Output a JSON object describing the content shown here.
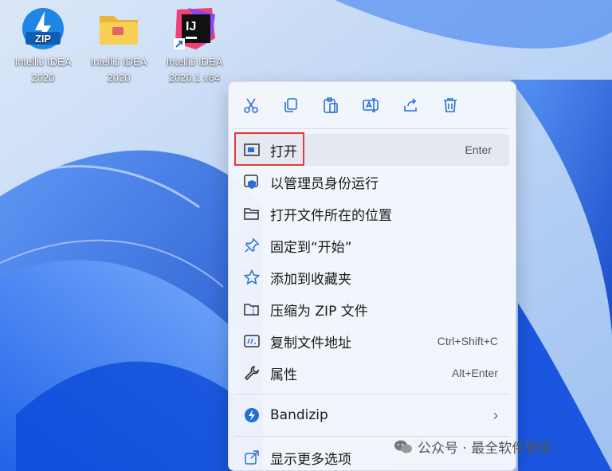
{
  "desktop": {
    "icons": [
      {
        "line1": "IntelliJ IDEA",
        "line2": "2020",
        "icon": "bandizip-zip-icon",
        "badge": "ZIP"
      },
      {
        "line1": "IntelliJ IDEA",
        "line2": "2020",
        "icon": "folder-icon"
      },
      {
        "line1": "IntelliJ IDEA",
        "line2": "2020.1 x64",
        "icon": "intellij-idea-icon",
        "badge": "IJ"
      }
    ]
  },
  "menu": {
    "toolbar": [
      "cut-icon",
      "copy-icon",
      "paste-icon",
      "rename-icon",
      "share-icon",
      "delete-icon"
    ],
    "items": [
      {
        "label": "打开",
        "shortcut": "Enter"
      },
      {
        "label": "以管理员身份运行",
        "shortcut": ""
      },
      {
        "label": "打开文件所在的位置",
        "shortcut": ""
      },
      {
        "label": "固定到“开始”",
        "shortcut": ""
      },
      {
        "label": "添加到收藏夹",
        "shortcut": ""
      },
      {
        "label": "压缩为 ZIP 文件",
        "shortcut": ""
      },
      {
        "label": "复制文件地址",
        "shortcut": "Ctrl+Shift+C"
      },
      {
        "label": "属性",
        "shortcut": "Alt+Enter"
      }
    ],
    "bandizip": {
      "label": "Bandizip"
    },
    "more": {
      "label": "显示更多选项"
    }
  },
  "watermark": {
    "text": "公众号 · 最全软件管家"
  },
  "colors": {
    "accent": "#2b6fd6",
    "highlight_box": "#e23b3b"
  }
}
